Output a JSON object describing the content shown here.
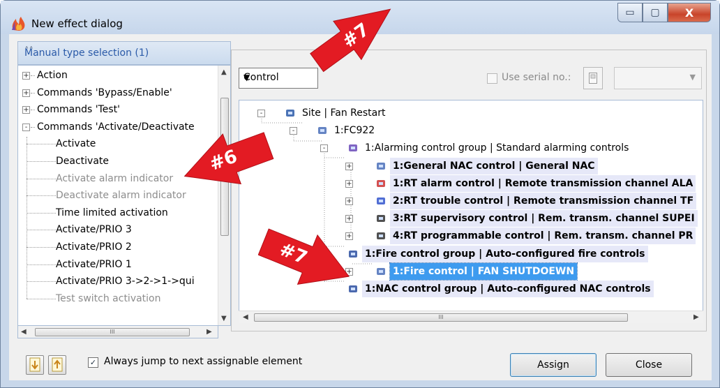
{
  "window": {
    "title": "New effect dialog",
    "minimize_symbol": "▭",
    "maximize_symbol": "▢",
    "close_symbol": "X"
  },
  "left_panel": {
    "header": "Manual type selection (1)",
    "items": [
      {
        "label": "Action",
        "expander": "+"
      },
      {
        "label": "Commands 'Bypass/Enable'",
        "expander": "+"
      },
      {
        "label": "Commands 'Test'",
        "expander": "+"
      },
      {
        "label": "Commands 'Activate/Deactivate",
        "expander": "-"
      },
      {
        "label": "Activate"
      },
      {
        "label": "Deactivate"
      },
      {
        "label": "Activate alarm indicator"
      },
      {
        "label": "Deactivate alarm indicator"
      },
      {
        "label": "Time limited activation"
      },
      {
        "label": "Activate/PRIO 3"
      },
      {
        "label": "Activate/PRIO 2"
      },
      {
        "label": "Activate/PRIO 1"
      },
      {
        "label": "Activate/PRIO 3->2->1->qui"
      },
      {
        "label": "Test switch activation"
      }
    ]
  },
  "right_panel": {
    "combo_value": "Control",
    "use_serial_label": "Use serial no.:",
    "tree": [
      {
        "label": "Site | Fan Restart",
        "icon": "site-icon"
      },
      {
        "label": "1:FC922",
        "icon": "panel-icon"
      },
      {
        "label": "1:Alarming control group | Standard alarming controls",
        "icon": "control-group-icon"
      },
      {
        "label": "1:General NAC control | General NAC",
        "icon": "horn-icon"
      },
      {
        "label": "1:RT alarm control | Remote transmission channel ALA",
        "icon": "rt-alarm-icon"
      },
      {
        "label": "2:RT trouble control | Remote transmission channel TF",
        "icon": "rt-trouble-icon"
      },
      {
        "label": "3:RT supervisory control | Rem. transm. channel SUPEI",
        "icon": "rt-supervisory-icon"
      },
      {
        "label": "4:RT programmable control | Rem. transm. channel PR",
        "icon": "rt-programmable-icon"
      },
      {
        "label": "1:Fire control group | Auto-configured fire controls",
        "icon": "fire-group-icon"
      },
      {
        "label": "1:Fire control | FAN SHUTDOEWN",
        "icon": "fire-control-icon"
      },
      {
        "label": "1:NAC control group | Auto-configured NAC controls",
        "icon": "nac-group-icon"
      }
    ]
  },
  "bottom": {
    "jump_label": "Always jump to next assignable element",
    "jump_checked": "✓",
    "assign_label": "Assign",
    "close_label": "Close"
  },
  "annotations": {
    "arrow_top": "#7",
    "arrow_left": "#6",
    "arrow_tree": "#7",
    "color": "#e31b23"
  },
  "scroll": {
    "ellipsis": "III",
    "up": "▲",
    "down": "▼",
    "left": "◀",
    "right": "▶"
  }
}
